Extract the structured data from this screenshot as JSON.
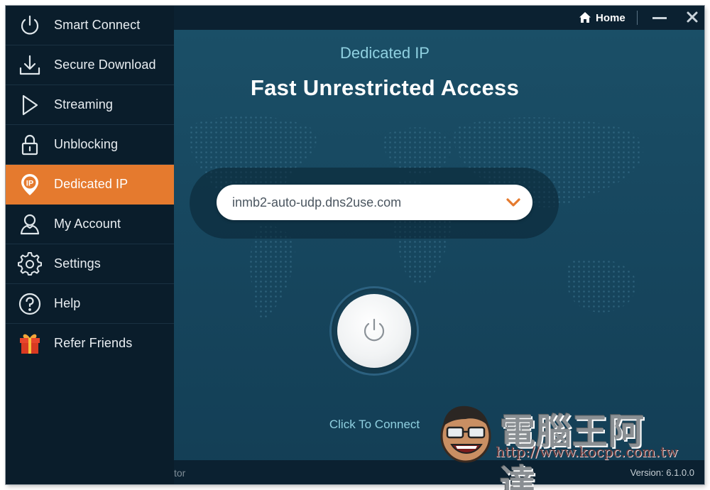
{
  "sidebar": {
    "items": [
      {
        "label": "Smart Connect",
        "icon": "power-icon"
      },
      {
        "label": "Secure Download",
        "icon": "download-icon"
      },
      {
        "label": "Streaming",
        "icon": "play-icon"
      },
      {
        "label": "Unblocking",
        "icon": "lock-icon"
      },
      {
        "label": "Dedicated IP",
        "icon": "ip-pin-icon",
        "active": true
      },
      {
        "label": "My Account",
        "icon": "user-icon"
      },
      {
        "label": "Settings",
        "icon": "gear-icon"
      },
      {
        "label": "Help",
        "icon": "help-icon"
      },
      {
        "label": "Refer Friends",
        "icon": "gift-icon"
      }
    ]
  },
  "titlebar": {
    "home_label": "Home"
  },
  "main": {
    "subtitle": "Dedicated IP",
    "headline": "Fast Unrestricted Access",
    "server_value": "inmb2-auto-udp.dns2use.com",
    "connect_label": "Click To Connect"
  },
  "statusbar": {
    "truncated_text": "tor",
    "version": "Version:  6.1.0.0"
  },
  "watermark": {
    "title": "電腦王阿達",
    "url": "http://www.kocpc.com.tw"
  },
  "colors": {
    "sidebar_bg": "#0a1d2b",
    "active_accent": "#e57a2e",
    "main_bg": "#17475f",
    "subtitle_text": "#8fd0e0",
    "gift_red": "#e8452c"
  }
}
